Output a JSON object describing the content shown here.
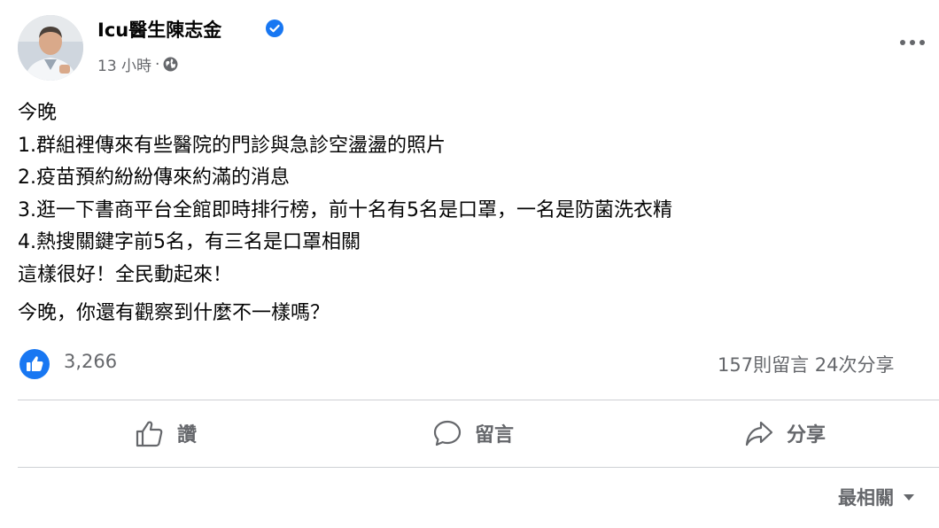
{
  "post": {
    "author": "Icu醫生陳志金",
    "time": "13 小時",
    "separator": "·",
    "icons": {
      "verified": "verified-check-icon",
      "audience": "globe-icon",
      "more": "more-options-icon"
    },
    "lines": [
      "今晚",
      "1.群組裡傳來有些醫院的門診與急診空盪盪的照片",
      "2.疫苗預約紛紛傳來約滿的消息",
      "3.逛一下書商平台全館即時排行榜，前十名有5名是口罩，一名是防菌洗衣精",
      "4.熱搜關鍵字前5名，有三名是口罩相關",
      "這樣很好！全民動起來！"
    ],
    "question": "今晚，你還有觀察到什麼不一樣嗎？"
  },
  "reactions": {
    "count": "3,266",
    "comments": "157則留言",
    "shares": "24次分享"
  },
  "actions": {
    "like": "讚",
    "comment": "留言",
    "share": "分享"
  },
  "comments_sort": {
    "label": "最相關"
  },
  "colors": {
    "brand_blue": "#1877f2",
    "secondary_text": "#65676b",
    "divider": "#ced0d4"
  }
}
